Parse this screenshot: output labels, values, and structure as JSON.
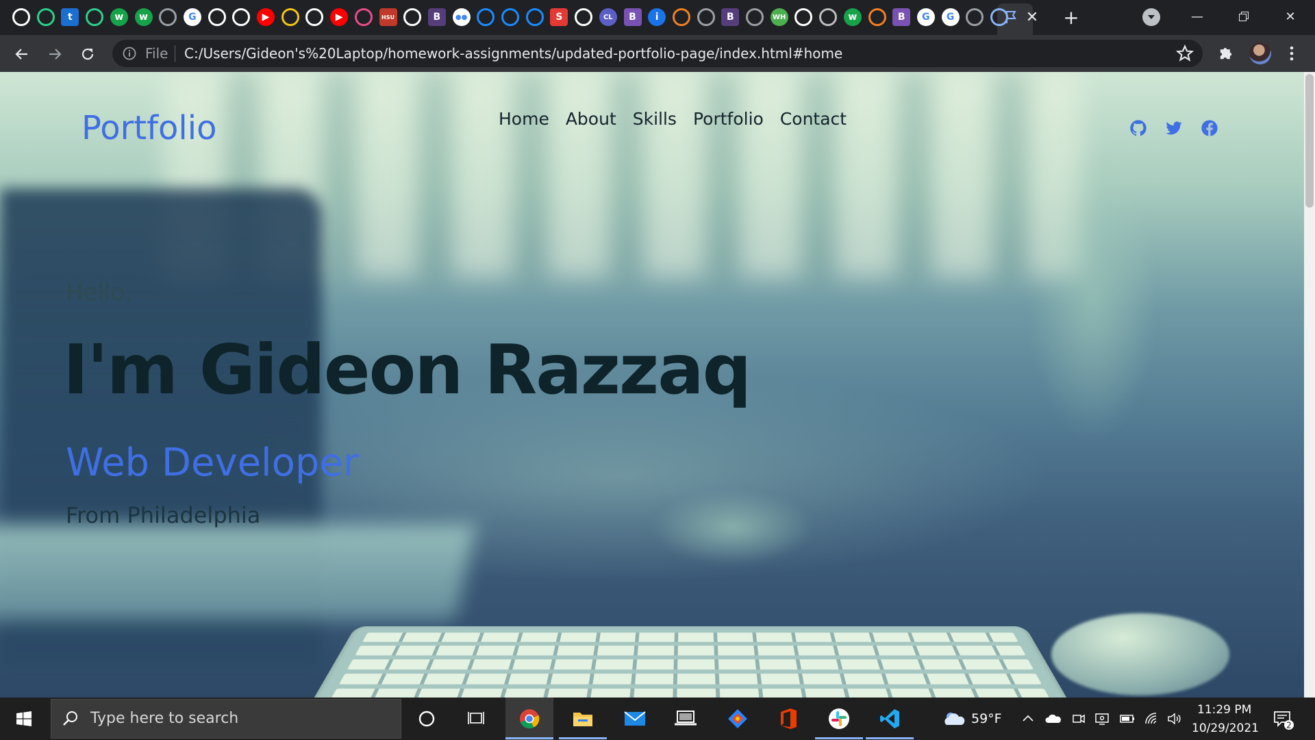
{
  "browser": {
    "tab_favicons": [
      {
        "name": "github-favicon",
        "color": "#ffffff",
        "glyph": ""
      },
      {
        "name": "generic-green-favicon",
        "color": "#2bd08f",
        "glyph": ""
      },
      {
        "name": "t-favicon",
        "color": "#1b6fd1",
        "glyph": "t"
      },
      {
        "name": "generic-green-favicon",
        "color": "#2bd08f",
        "glyph": ""
      },
      {
        "name": "w-favicon",
        "color": "#16a34a",
        "glyph": "w"
      },
      {
        "name": "w-favicon",
        "color": "#16a34a",
        "glyph": "w"
      },
      {
        "name": "globe-favicon",
        "color": "#9aa0a6",
        "glyph": ""
      },
      {
        "name": "google-favicon",
        "color": "#ffffff",
        "glyph": "G"
      },
      {
        "name": "github-favicon",
        "color": "#ffffff",
        "glyph": ""
      },
      {
        "name": "github-favicon",
        "color": "#ffffff",
        "glyph": ""
      },
      {
        "name": "youtube-favicon",
        "color": "#ff0000",
        "glyph": "▶"
      },
      {
        "name": "generic-yellow-favicon",
        "color": "#f5c518",
        "glyph": ""
      },
      {
        "name": "generic-white-favicon",
        "color": "#ffffff",
        "glyph": ""
      },
      {
        "name": "youtube-favicon",
        "color": "#ff0000",
        "glyph": "▶"
      },
      {
        "name": "dribbble-favicon",
        "color": "#ea4c89",
        "glyph": ""
      },
      {
        "name": "hsu-favicon",
        "color": "#c0392b",
        "glyph": "HSU"
      },
      {
        "name": "github-favicon",
        "color": "#ffffff",
        "glyph": ""
      },
      {
        "name": "bootstrap-favicon",
        "color": "#563d7c",
        "glyph": "B"
      },
      {
        "name": "medium-favicon",
        "color": "#ffffff",
        "glyph": "●●"
      },
      {
        "name": "blue-flag-favicon",
        "color": "#1a8cff",
        "glyph": ""
      },
      {
        "name": "blue-flag-favicon",
        "color": "#1a8cff",
        "glyph": ""
      },
      {
        "name": "blue-flag-favicon",
        "color": "#1a8cff",
        "glyph": ""
      },
      {
        "name": "s-favicon",
        "color": "#e53935",
        "glyph": "S"
      },
      {
        "name": "github-favicon",
        "color": "#ffffff",
        "glyph": ""
      },
      {
        "name": "cl-favicon",
        "color": "#5b5fc7",
        "glyph": "CL"
      },
      {
        "name": "bootstrap-favicon",
        "color": "#7952b3",
        "glyph": "B"
      },
      {
        "name": "info-favicon",
        "color": "#1a73e8",
        "glyph": "i"
      },
      {
        "name": "stackoverflow-favicon",
        "color": "#f48024",
        "glyph": ""
      },
      {
        "name": "globe-favicon",
        "color": "#9aa0a6",
        "glyph": ""
      },
      {
        "name": "bootstrap-favicon",
        "color": "#563d7c",
        "glyph": "B"
      },
      {
        "name": "globe-favicon",
        "color": "#9aa0a6",
        "glyph": ""
      },
      {
        "name": "wh-favicon",
        "color": "#4caf50",
        "glyph": "WH"
      },
      {
        "name": "github-favicon",
        "color": "#ffffff",
        "glyph": ""
      },
      {
        "name": "grid-favicon",
        "color": "#bdbdbd",
        "glyph": ""
      },
      {
        "name": "w-favicon",
        "color": "#16a34a",
        "glyph": "w"
      },
      {
        "name": "stackoverflow-favicon",
        "color": "#f48024",
        "glyph": ""
      },
      {
        "name": "bootstrap-favicon",
        "color": "#7952b3",
        "glyph": "B"
      },
      {
        "name": "google-favicon",
        "color": "#ffffff",
        "glyph": "G"
      },
      {
        "name": "google-favicon",
        "color": "#ffffff",
        "glyph": "G"
      },
      {
        "name": "globe-favicon",
        "color": "#9aa0a6",
        "glyph": ""
      },
      {
        "name": "flag-favicon",
        "color": "#8ab4f8",
        "glyph": ""
      }
    ],
    "omnibox": {
      "scheme_label": "File",
      "url": "C:/Users/Gideon's%20Laptop/homework-assignments/updated-portfolio-page/index.html#home"
    }
  },
  "site": {
    "logo": "Portfolio",
    "nav": [
      "Home",
      "About",
      "Skills",
      "Portfolio",
      "Contact"
    ],
    "social_icons": [
      "github-icon",
      "twitter-icon",
      "facebook-icon"
    ],
    "accent_color": "#3f6fe3",
    "hero": {
      "greeting": "Hello,",
      "name": "I'm Gideon Razzaq",
      "role": "Web Developer",
      "location": "From Philadelphia"
    }
  },
  "taskbar": {
    "search_placeholder": "Type here to search",
    "pinned_apps": [
      "cortana-icon",
      "task-view-icon",
      "chrome-icon",
      "file-explorer-icon",
      "mail-icon",
      "laptop-app-icon",
      "sourcetree-icon",
      "office-icon",
      "slack-icon",
      "vscode-icon"
    ],
    "weather_temp": "59°F",
    "clock_time": "11:29 PM",
    "clock_date": "10/29/2021",
    "notification_count": "2"
  }
}
